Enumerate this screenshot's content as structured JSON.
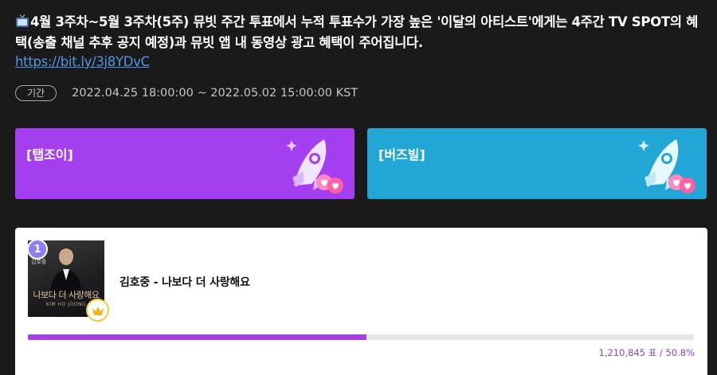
{
  "notice": {
    "icon": "tv-icon",
    "text": "4월 3주차~5월 3주차(5주) 뮤빗 주간 투표에서 누적 투표수가 가장 높은 '이달의 아티스트'에게는 4주간 TV SPOT의 혜택(송출 채널 추후 공지 예정)과 뮤빗 앱 내 동영상 광고 혜택이 주어집니다.",
    "link": "https://bit.ly/3j8YDvC"
  },
  "period": {
    "label": "기간",
    "value": "2022.04.25 18:00:00 ~ 2022.05.02 15:00:00 KST"
  },
  "vote_options": [
    {
      "label": "[탭조이]",
      "color": "#a43ff0",
      "icon": "rocket-icon"
    },
    {
      "label": "[버즈빌]",
      "color": "#21a6d6",
      "icon": "rocket-icon"
    }
  ],
  "ranking": {
    "rank": "1",
    "cover_artist": "김호중",
    "cover_title": "나보다 더 사랑해요",
    "cover_subtitle": "KIM HO JOONG",
    "song": "김호중 - 나보다 더 사랑해요",
    "vote_share": 0.508,
    "votes_text": "1,210,845 표 / 50.8%",
    "crown_icon": "crown-icon"
  }
}
